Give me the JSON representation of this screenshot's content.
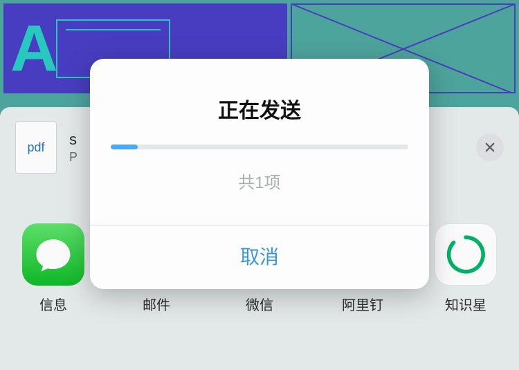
{
  "modal": {
    "title": "正在发送",
    "subtitle": "共1项",
    "cancel": "取消",
    "progress_percent": 9
  },
  "doc": {
    "thumb_label": "pdf",
    "name_first_letter": "s",
    "sub_first_letter": "P"
  },
  "apps": [
    {
      "key": "messages",
      "label": "信息",
      "icon": "messages-icon"
    },
    {
      "key": "mail",
      "label": "邮件",
      "icon": "mail-icon"
    },
    {
      "key": "wechat",
      "label": "微信",
      "icon": "wechat-icon"
    },
    {
      "key": "dingtalk",
      "label": "阿里钉",
      "icon": "dingtalk-icon"
    },
    {
      "key": "zsxq",
      "label": "知识星",
      "icon": "star-icon"
    }
  ]
}
